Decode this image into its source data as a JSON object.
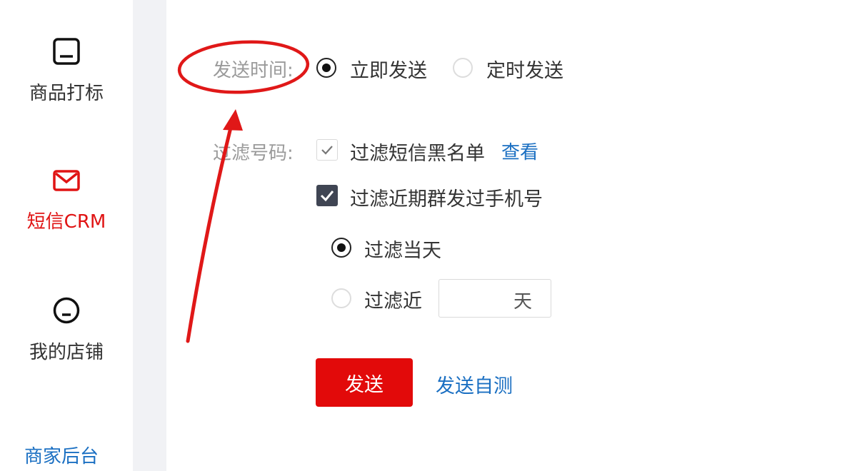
{
  "sidebar": {
    "items": [
      {
        "label": "商品打标",
        "icon": "tablet-icon",
        "active": false
      },
      {
        "label": "短信CRM",
        "icon": "mail-icon",
        "active": true
      },
      {
        "label": "我的店铺",
        "icon": "smiley-icon",
        "active": false
      }
    ],
    "bottom_link": "商家后台"
  },
  "form": {
    "send_time": {
      "label": "发送时间:",
      "options": [
        {
          "label": "立即发送",
          "selected": true
        },
        {
          "label": "定时发送",
          "selected": false
        }
      ]
    },
    "filter": {
      "label": "过滤号码:",
      "blacklist": {
        "label": "过滤短信黑名单",
        "checked": true,
        "view_link": "查看"
      },
      "recent": {
        "label": "过滤近期群发过手机号",
        "checked": true
      },
      "period_options": [
        {
          "label": "过滤当天",
          "selected": true
        },
        {
          "label": "过滤近",
          "selected": false
        }
      ],
      "days": {
        "value": "",
        "unit": "天"
      }
    },
    "send_button": "发送",
    "self_test_link": "发送自测"
  },
  "colors": {
    "accent": "#e20a0a",
    "link": "#1a6fc2",
    "annotation": "#e01818"
  }
}
